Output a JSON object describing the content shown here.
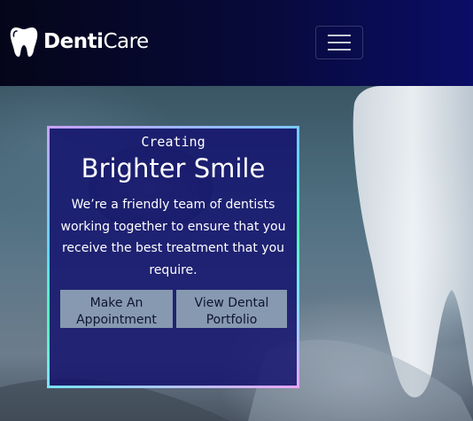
{
  "header": {
    "logo_bold": "Denti",
    "logo_light": "Care",
    "logo_icon": "tooth-icon",
    "menu_icon": "hamburger-icon"
  },
  "hero": {
    "subtitle": "Creating",
    "title": "Brighter Smile",
    "description": "We’re a friendly team of dentists working together to ensure that you receive the best treatment that you require.",
    "primary_button": "Make An Appointment",
    "secondary_button": "View Dental Portfolio"
  },
  "colors": {
    "nav_start": "#05051a",
    "nav_end": "#0b0d66",
    "card_bg": "#12106e",
    "button_bg": "#8799b0",
    "text": "#ffffff"
  }
}
